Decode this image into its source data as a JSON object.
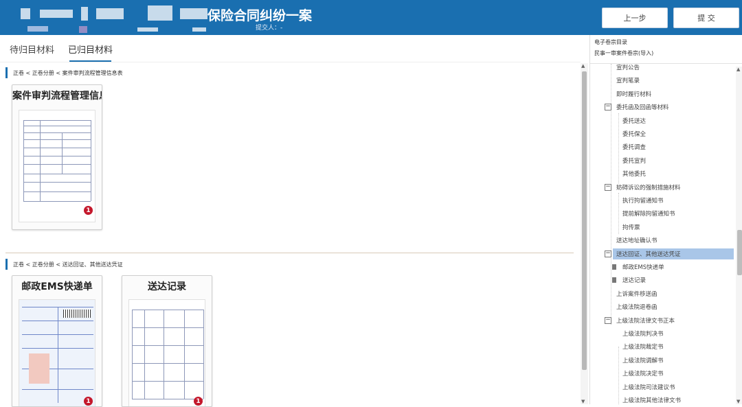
{
  "header": {
    "case_title": "保险合同纠纷一案",
    "submitter": "提交人：-",
    "prev_button": "上一步",
    "submit_button": "提 交",
    "colors": {
      "header_bg": "#1a6fb0",
      "badge": "#c4182c",
      "selection": "#a9c6e8"
    }
  },
  "tabs": [
    {
      "label": "待归目材料",
      "active": false
    },
    {
      "label": "已归目材料",
      "active": true
    }
  ],
  "sections": [
    {
      "breadcrumb": "正卷 < 正卷分册 < 案件审判流程管理信息表",
      "cards": [
        {
          "title": "案件审判流程管理信息表",
          "badge": "1"
        }
      ]
    },
    {
      "breadcrumb": "正卷 < 正卷分册 < 送达回证、其他送达凭证",
      "cards": [
        {
          "title": "邮政EMS快递单",
          "badge": "1"
        },
        {
          "title": "送达记录",
          "badge": "1"
        }
      ]
    }
  ],
  "right_panel": {
    "title": "电子卷宗目录",
    "subtitle": "民事一审案件卷宗(导入)",
    "tree": [
      {
        "label": "宣判公告"
      },
      {
        "label": "宣判笔录"
      },
      {
        "label": "即时履行材料"
      },
      {
        "label": "委托函及回函等材料",
        "toggle": "−"
      },
      {
        "label": "委托送达"
      },
      {
        "label": "委托保全"
      },
      {
        "label": "委托调查"
      },
      {
        "label": "委托宣判"
      },
      {
        "label": "其他委托"
      },
      {
        "label": "妨碍诉讼的强制措施材料",
        "toggle": "−"
      },
      {
        "label": "执行拘留通知书"
      },
      {
        "label": "提前解除拘留通知书"
      },
      {
        "label": "拘传票"
      },
      {
        "label": "送达地址确认书"
      },
      {
        "label": "送达回证、其他送达凭证",
        "toggle": "−",
        "selected": true
      },
      {
        "label": "邮政EMS快递单",
        "icon": "file-icon"
      },
      {
        "label": "送达记录",
        "icon": "file-icon"
      },
      {
        "label": "上诉案件移送函"
      },
      {
        "label": "上级法院退卷函"
      },
      {
        "label": "上级法院法律文书正本",
        "toggle": "−"
      },
      {
        "label": "上级法院判决书"
      },
      {
        "label": "上级法院裁定书"
      },
      {
        "label": "上级法院调解书"
      },
      {
        "label": "上级法院决定书"
      },
      {
        "label": "上级法院司法建议书"
      },
      {
        "label": "上级法院其他法律文书"
      }
    ]
  }
}
